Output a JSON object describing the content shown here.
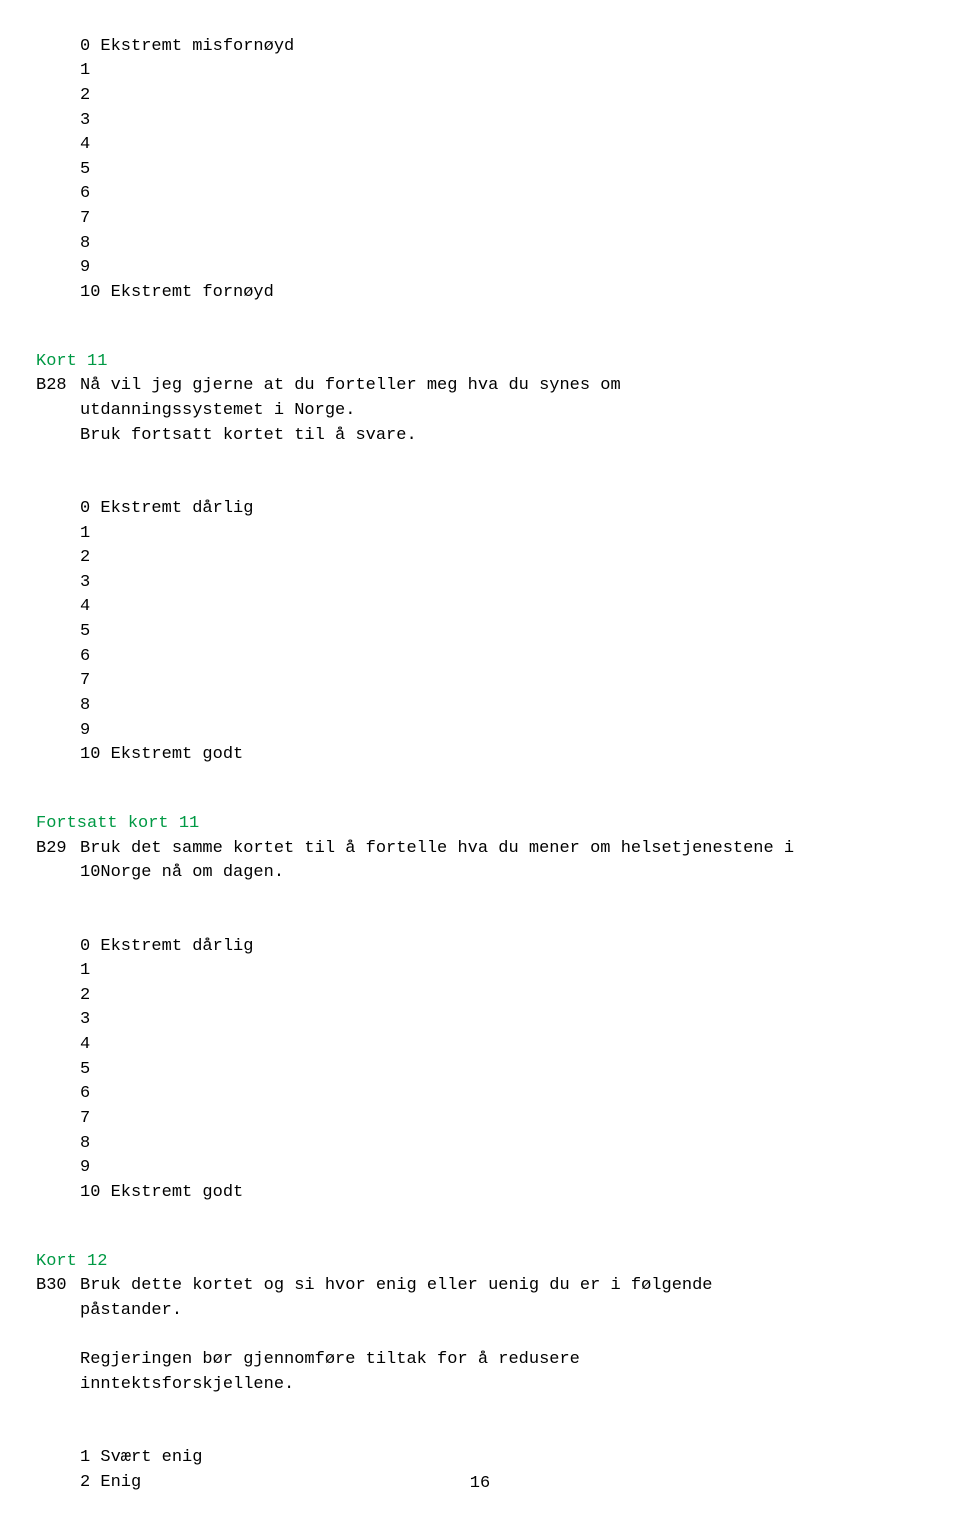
{
  "q_b28_pre_scale": {
    "s0": "0 Ekstremt misfornøyd",
    "s1": "1",
    "s2": "2",
    "s3": "3",
    "s4": "4",
    "s5": "5",
    "s6": "6",
    "s7": "7",
    "s8": "8",
    "s9": "9",
    "s10": "10 Ekstremt fornøyd"
  },
  "kort11": "Kort 11",
  "b28": {
    "code": "B28",
    "line1": "Nå vil jeg gjerne at du forteller meg hva du synes om",
    "line2": "utdanningssystemet i Norge.",
    "line3": "Bruk fortsatt kortet til å svare."
  },
  "b28_scale": {
    "s0": "0 Ekstremt dårlig",
    "s1": "1",
    "s2": "2",
    "s3": "3",
    "s4": "4",
    "s5": "5",
    "s6": "6",
    "s7": "7",
    "s8": "8",
    "s9": "9",
    "s10": "10 Ekstremt godt"
  },
  "fortsatt_kort11": "Fortsatt kort 11",
  "b29": {
    "code": "B29",
    "line1": "Bruk det samme kortet til å fortelle hva du mener om helsetjenestene i",
    "line2": "10Norge nå om dagen."
  },
  "b29_scale": {
    "s0": "0 Ekstremt dårlig",
    "s1": "1",
    "s2": "2",
    "s3": "3",
    "s4": "4",
    "s5": "5",
    "s6": "6",
    "s7": "7",
    "s8": "8",
    "s9": "9",
    "s10": "10 Ekstremt godt"
  },
  "kort12": "Kort 12",
  "b30": {
    "code": "B30",
    "line1": "Bruk dette kortet og si hvor enig eller uenig du er i følgende",
    "line2": "påstander.",
    "line3": "Regjeringen bør gjennomføre tiltak for å redusere",
    "line4": "inntektsforskjellene."
  },
  "b30_scale": {
    "s1": "1 Svært enig",
    "s2": "2 Enig"
  },
  "page_number": "16"
}
